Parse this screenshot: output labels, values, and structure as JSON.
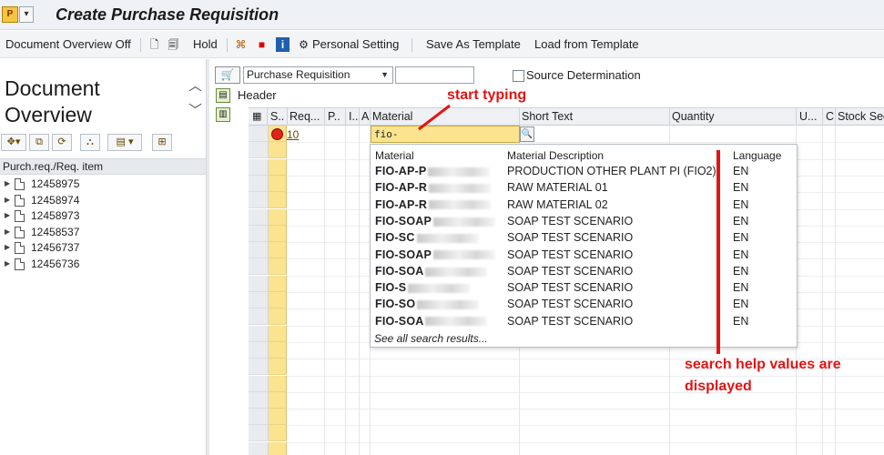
{
  "window": {
    "title": "Create Purchase Requisition",
    "app_icon": "sap-app-icon",
    "app_icon_glyph": "P",
    "menu_icon_glyph": "▾"
  },
  "toolbar": {
    "document_overview_off": "Document Overview Off",
    "hold": "Hold",
    "personal_setting": "Personal Setting",
    "save_as_template": "Save As Template",
    "load_from_template": "Load from Template",
    "icons": [
      "new-document-icon",
      "other-document-icon",
      "hold-icon",
      "tree-icon",
      "error-icon",
      "info-icon",
      "personal-setting-icon"
    ]
  },
  "left_panel": {
    "title_line1": "Document",
    "title_line2": "Overview",
    "chev_up": "^",
    "chev_down": "v",
    "tree_header": "Purch.req./Req. item",
    "items": [
      "12458975",
      "12458974",
      "12458973",
      "12458537",
      "12456737",
      "12456736"
    ]
  },
  "doc_header": {
    "doc_type": "Purchase Requisition",
    "doc_number": "",
    "source_determination_label": "Source Determination",
    "source_determination_checked": false,
    "header_label": "Header"
  },
  "grid": {
    "columns": [
      "S..",
      "Req...",
      "P..",
      "I..",
      "A",
      "Material",
      "Short Text",
      "Quantity",
      "U...",
      "C",
      "Stock Seg"
    ],
    "row1": {
      "req_item": "10",
      "material_input": "fio-"
    }
  },
  "search_help": {
    "headers": [
      "Material",
      "Material Description",
      "Language"
    ],
    "rows": [
      {
        "material": "FIO-AP-P",
        "description": "PRODUCTION OTHER PLANT PI (FIO2)",
        "language": "EN"
      },
      {
        "material": "FIO-AP-R",
        "description": "RAW MATERIAL 01",
        "language": "EN"
      },
      {
        "material": "FIO-AP-R",
        "description": "RAW MATERIAL 02",
        "language": "EN"
      },
      {
        "material": "FIO-SOAP",
        "description": "SOAP TEST SCENARIO",
        "language": "EN"
      },
      {
        "material": "FIO-SC",
        "description": "SOAP TEST SCENARIO",
        "language": "EN"
      },
      {
        "material": "FIO-SOAP",
        "description": "SOAP TEST SCENARIO",
        "language": "EN"
      },
      {
        "material": "FIO-SOA",
        "description": "SOAP TEST SCENARIO",
        "language": "EN"
      },
      {
        "material": "FIO-S",
        "description": "SOAP TEST SCENARIO",
        "language": "EN"
      },
      {
        "material": "FIO-SO",
        "description": "SOAP TEST SCENARIO",
        "language": "EN"
      },
      {
        "material": "FIO-SOA",
        "description": "SOAP TEST SCENARIO",
        "language": "EN"
      }
    ],
    "see_all": "See all search results..."
  },
  "annotations": {
    "start_typing": "start typing",
    "search_help_line1": "search help values are",
    "search_help_line2": "displayed",
    "color": "#e31414"
  }
}
